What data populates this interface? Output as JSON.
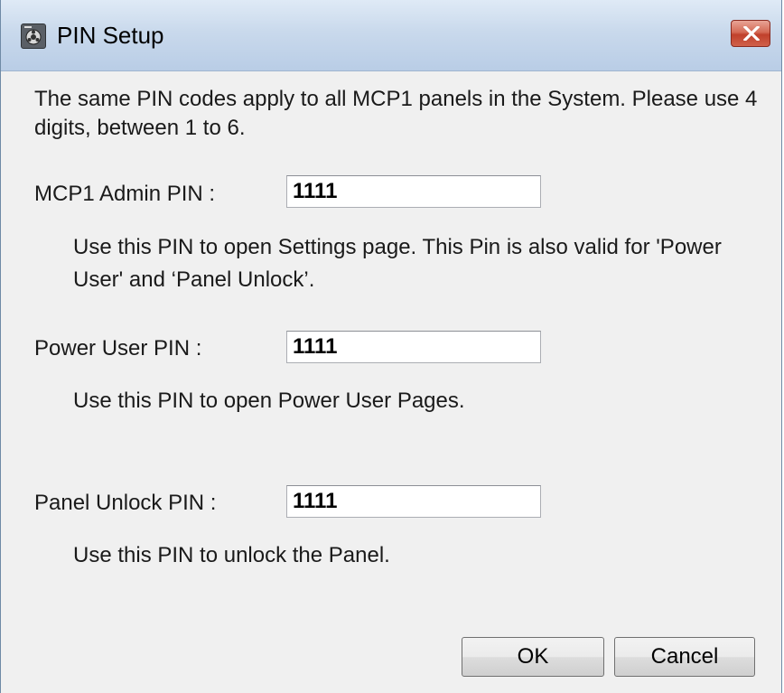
{
  "window": {
    "title": "PIN Setup",
    "close_icon": "close-icon"
  },
  "intro_text": "The same PIN codes apply to all MCP1 panels in the System. Please use 4 digits, between 1 to 6.",
  "fields": [
    {
      "label": "MCP1 Admin PIN :",
      "value": "1111",
      "description": "Use this PIN to open Settings page. This Pin is also valid for 'Power User' and ‘Panel Unlock’."
    },
    {
      "label": "Power User PIN :",
      "value": "1111",
      "description": "Use this PIN to open Power User Pages."
    },
    {
      "label": "Panel Unlock PIN :",
      "value": "1111",
      "description": "Use this PIN to unlock the Panel."
    }
  ],
  "buttons": {
    "ok_label": "OK",
    "cancel_label": "Cancel"
  },
  "colors": {
    "close_button": "#c94a35",
    "dialog_background": "#f0f0f0",
    "titlebar": "#c9d9ec"
  }
}
